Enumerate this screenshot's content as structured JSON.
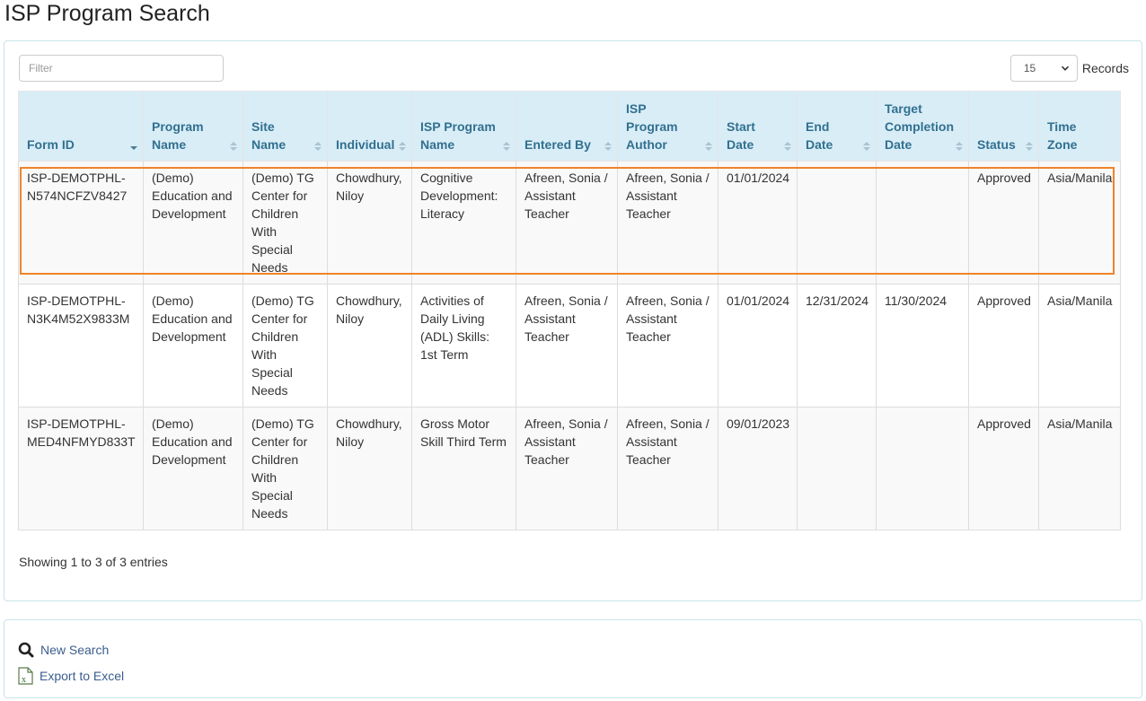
{
  "page": {
    "title": "ISP Program Search"
  },
  "filter": {
    "placeholder": "Filter",
    "value": ""
  },
  "records": {
    "selected": "15",
    "label": "Records"
  },
  "table": {
    "columns": [
      {
        "label": "Form ID",
        "sort": "desc"
      },
      {
        "label": "Program Name",
        "sort": "both"
      },
      {
        "label": "Site Name",
        "sort": "both"
      },
      {
        "label": "Individual",
        "sort": "both"
      },
      {
        "label": "ISP Program Name",
        "sort": "both"
      },
      {
        "label": "Entered By",
        "sort": "both"
      },
      {
        "label": "ISP Program Author",
        "sort": "both"
      },
      {
        "label": "Start Date",
        "sort": "both"
      },
      {
        "label": "End Date",
        "sort": "both"
      },
      {
        "label": "Target Completion Date",
        "sort": "both"
      },
      {
        "label": "Status",
        "sort": "both"
      },
      {
        "label": "Time Zone",
        "sort": "none"
      }
    ],
    "rows": [
      {
        "selected": true,
        "cells": [
          "ISP-DEMOTPHL-N574NCFZV8427",
          "(Demo) Education and Development",
          "(Demo) TG Center for Children With Special Needs",
          "Chowdhury, Niloy",
          "Cognitive Development: Literacy",
          "Afreen, Sonia / Assistant Teacher",
          "Afreen, Sonia / Assistant Teacher",
          "01/01/2024",
          "",
          "",
          "Approved",
          "Asia/Manila"
        ]
      },
      {
        "selected": false,
        "cells": [
          "ISP-DEMOTPHL-N3K4M52X9833M",
          "(Demo) Education and Development",
          "(Demo) TG Center for Children With Special Needs",
          "Chowdhury, Niloy",
          "Activities of Daily Living (ADL) Skills: 1st Term",
          "Afreen, Sonia / Assistant Teacher",
          "Afreen, Sonia / Assistant Teacher",
          "01/01/2024",
          "12/31/2024",
          "11/30/2024",
          "Approved",
          "Asia/Manila"
        ]
      },
      {
        "selected": false,
        "cells": [
          "ISP-DEMOTPHL-MED4NFMYD833T",
          "(Demo) Education and Development",
          "(Demo) TG Center for Children With Special Needs",
          "Chowdhury, Niloy",
          "Gross Motor Skill Third Term",
          "Afreen, Sonia / Assistant Teacher",
          "Afreen, Sonia / Assistant Teacher",
          "09/01/2023",
          "",
          "",
          "Approved",
          "Asia/Manila"
        ]
      }
    ]
  },
  "info": "Showing 1 to 3 of 3 entries",
  "actions": {
    "new_search": {
      "label": "New Search",
      "icon": "search-icon"
    },
    "export": {
      "label": "Export to Excel",
      "icon": "excel-file-icon"
    }
  },
  "colors": {
    "header_bg": "#d9edf7",
    "header_text": "#31708f",
    "selection_outline": "#f0832a",
    "link": "#3b5d8d"
  }
}
